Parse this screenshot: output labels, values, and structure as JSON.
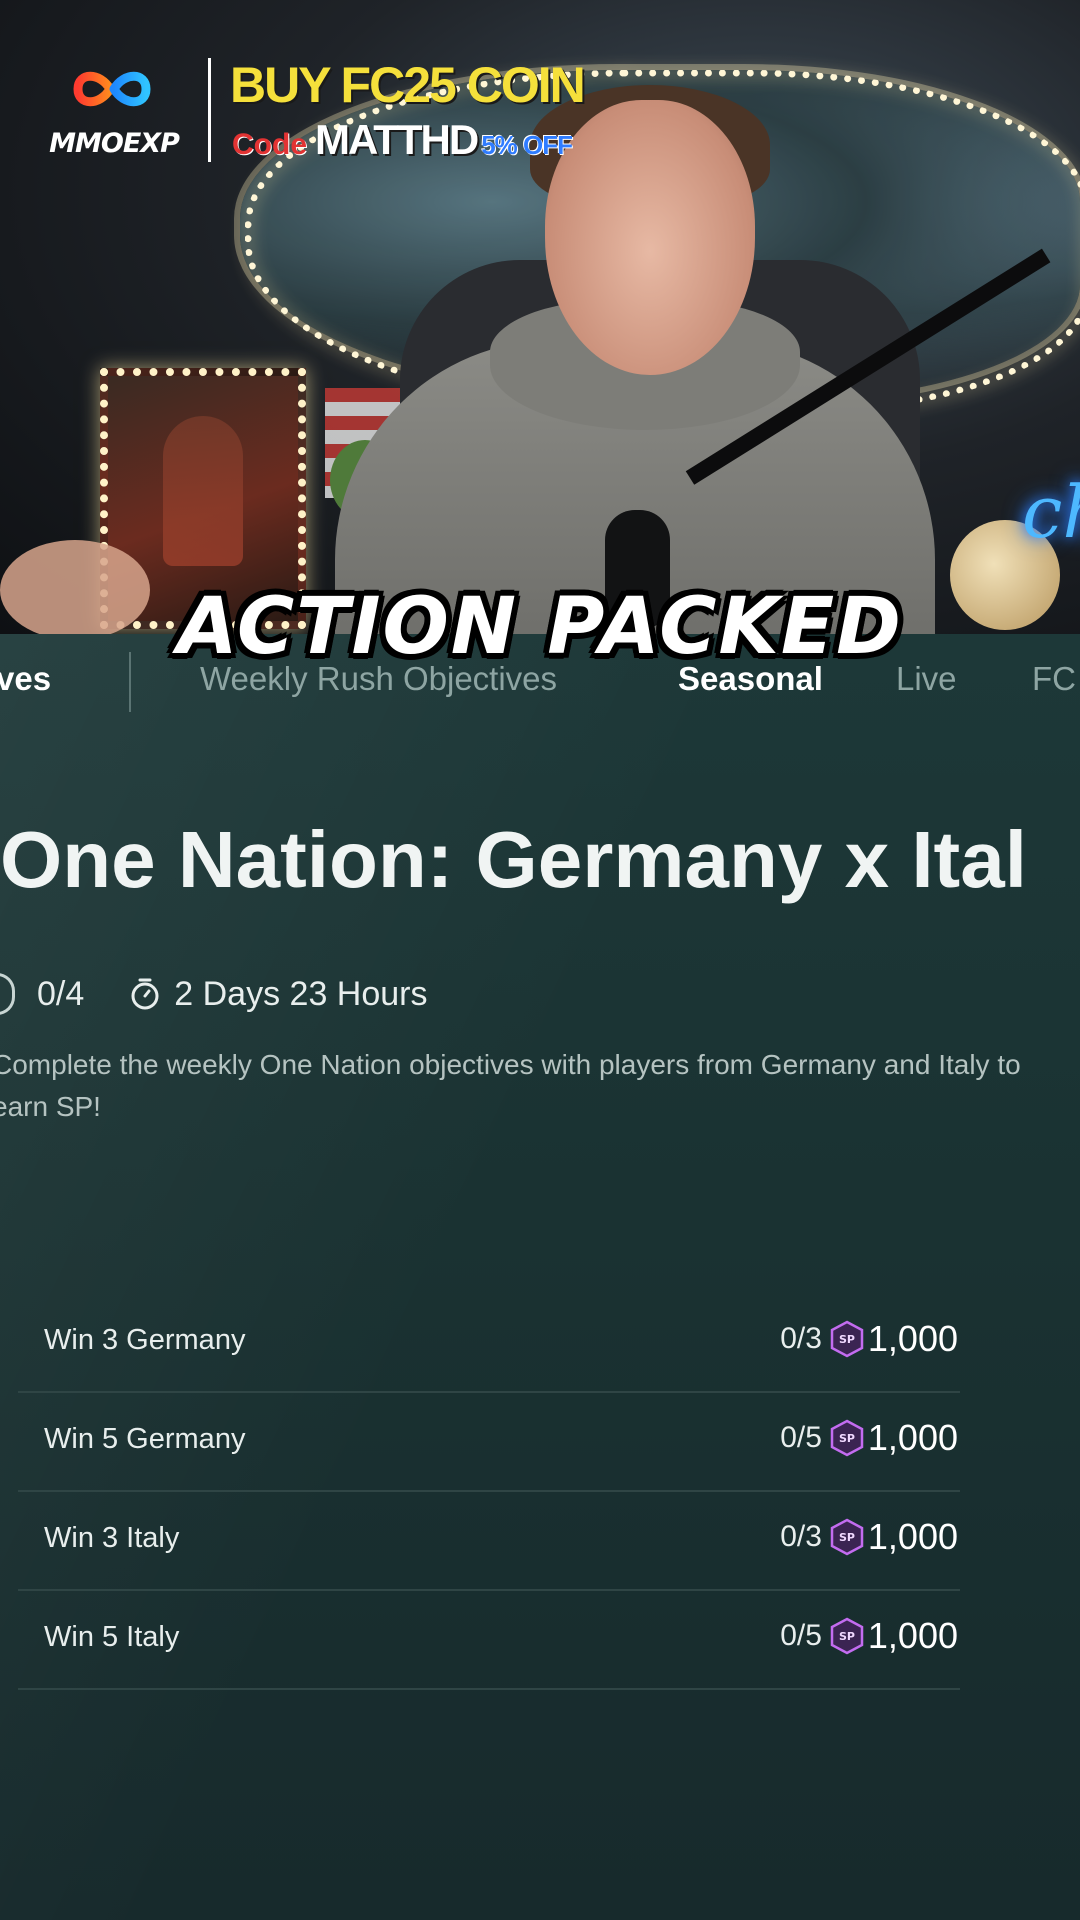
{
  "sponsor": {
    "brand": "MMOEXP",
    "headline": "BUY FC25 COIN",
    "code_label": "Code",
    "code": "MATTHD",
    "discount": "5% OFF",
    "colors": {
      "headline": "#f5e03b",
      "code_label": "#e23333",
      "discount": "#2f7cff"
    }
  },
  "caption": "ACTION PACKED",
  "tabs": [
    {
      "label": "ves",
      "active": true
    },
    {
      "label": "Weekly Rush Objectives",
      "active": false
    },
    {
      "label": "Seasonal",
      "active": true
    },
    {
      "label": "Live",
      "active": false
    },
    {
      "label": "FC",
      "active": false
    }
  ],
  "objective": {
    "title": "One Nation: Germany x Ital",
    "progress": "0/4",
    "timer_icon": "stopwatch-icon",
    "time_left": "2 Days 23 Hours",
    "description": "Complete the weekly One Nation objectives with players from Germany and Italy to earn SP!"
  },
  "tasks": [
    {
      "label": "Win 3 Germany",
      "progress": "0/3",
      "reward_icon": "sp-icon",
      "reward": "1,000"
    },
    {
      "label": "Win 5 Germany",
      "progress": "0/5",
      "reward_icon": "sp-icon",
      "reward": "1,000"
    },
    {
      "label": "Win 3 Italy",
      "progress": "0/3",
      "reward_icon": "sp-icon",
      "reward": "1,000"
    },
    {
      "label": "Win 5 Italy",
      "progress": "0/5",
      "reward_icon": "sp-icon",
      "reward": "1,000"
    }
  ]
}
